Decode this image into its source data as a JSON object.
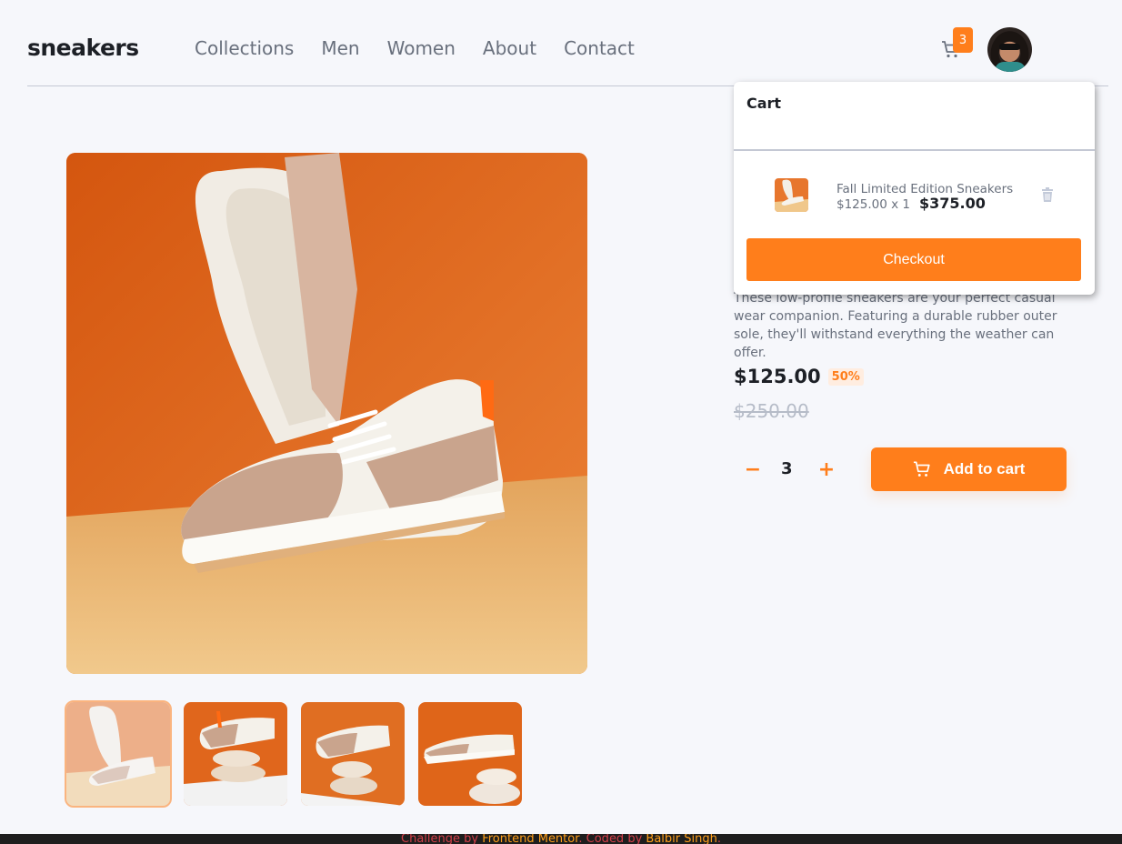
{
  "header": {
    "logo": "sneakers",
    "nav": [
      "Collections",
      "Men",
      "Women",
      "About",
      "Contact"
    ],
    "cart_count": "3"
  },
  "product": {
    "description": "These low-profile sneakers are your perfect casual wear companion. Featuring a durable rubber outer sole, they'll withstand everything the weather can offer.",
    "price": "$125.00",
    "discount": "50%",
    "old_price": "$250.00",
    "quantity": "3",
    "minus_label": "−",
    "plus_label": "+",
    "add_to_cart": "Add to cart"
  },
  "cart": {
    "title": "Cart",
    "item_name": "Fall Limited Edition Sneakers",
    "item_unit": "$125.00 x 1",
    "item_total": "$375.00",
    "checkout": "Checkout"
  },
  "footer": {
    "prefix": "Challenge by ",
    "challenge_link": "Frontend Mentor",
    "middle": ". Coded by ",
    "author_link": "Balbir Singh",
    "suffix": "."
  },
  "colors": {
    "accent": "#ff7e1b",
    "accent_light": "#ffede0",
    "text_dark": "#1d2026",
    "text_muted": "#69707d",
    "background": "#f6f7fb"
  },
  "icons": [
    "cart-icon",
    "avatar",
    "minus-icon",
    "plus-icon",
    "trash-icon"
  ]
}
